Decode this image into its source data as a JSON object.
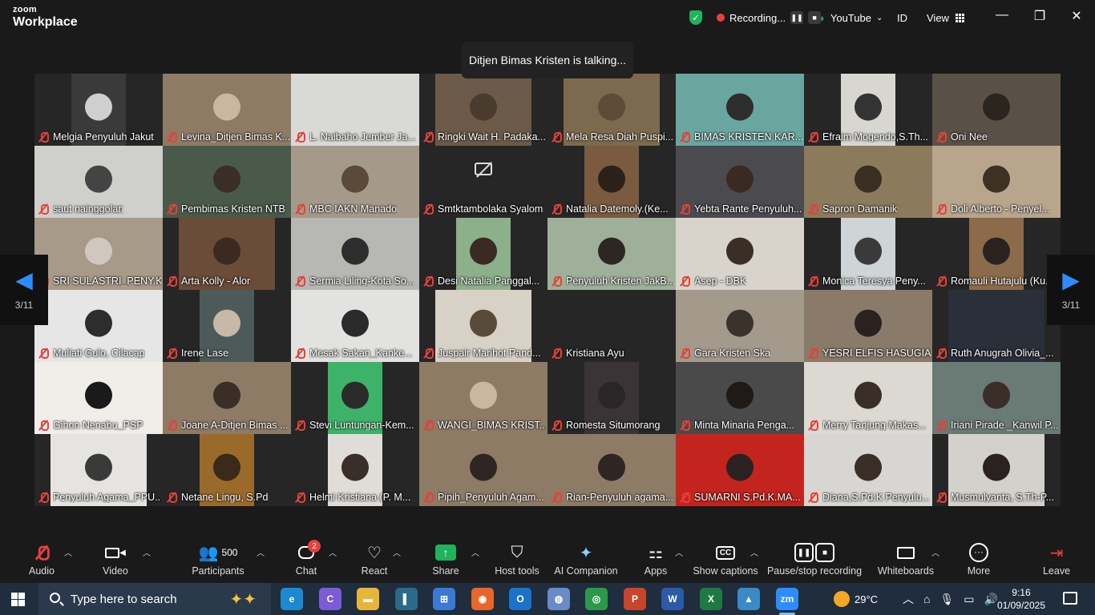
{
  "app": {
    "logo_top": "zoom",
    "logo_bottom": "Workplace"
  },
  "titlebar": {
    "recording_label": "Recording...",
    "stream_label": "YouTube",
    "id_label": "ID",
    "view_label": "View"
  },
  "talking_banner": "Ditjen Bimas Kristen is talking...",
  "pagination": {
    "left": "3/11",
    "right": "3/11"
  },
  "participants": [
    {
      "name": "Melgia Penyuluh Jakut",
      "bg": "#3a3a3a",
      "fg": "#cfcfcf",
      "vw": 68
    },
    {
      "name": "Levina_Ditjen Bimas K...",
      "bg": "#8d7b66",
      "fg": "#c9b7a1",
      "vw": 160
    },
    {
      "name": "L. Naibaho Jember Ja...",
      "bg": "#d9d9d6",
      "fg": "#d9d9d6",
      "vw": 160
    },
    {
      "name": "Ringki Wait H. Padaka...",
      "bg": "#6b5a48",
      "fg": "#4a3b2f",
      "vw": 120
    },
    {
      "name": "Mela Resa Diah Puspi...",
      "bg": "#7d6a4e",
      "fg": "#5e4b37",
      "vw": 120
    },
    {
      "name": "BIMAS KRISTEN KAR...",
      "bg": "#6aa6a0",
      "fg": "#2d2d2d",
      "vw": 160
    },
    {
      "name": "Efraim Mogendo,S.Th...",
      "bg": "#d8d6d0",
      "fg": "#333",
      "vw": 68
    },
    {
      "name": "Oni Nee",
      "bg": "#5a5146",
      "fg": "#2b2520",
      "vw": 160
    },
    {
      "name": "saut nainggolan",
      "bg": "#cfcfcb",
      "fg": "#444",
      "vw": 160
    },
    {
      "name": "Pembimas Kristen NTB",
      "bg": "#4a5a4a",
      "fg": "#3a2e26",
      "vw": 160
    },
    {
      "name": "MBC IAKN Manado",
      "bg": "#a59a8a",
      "fg": "#5b4a3a",
      "vw": 160
    },
    {
      "name": "Smtktambolaka Syalom",
      "bg": "#262626",
      "fg": "#262626",
      "vw": 0,
      "camoff": true
    },
    {
      "name": "Natalia Datemoly.(Ke...",
      "bg": "#7a5b40",
      "fg": "#2b211a",
      "vw": 68
    },
    {
      "name": "Yebta Rante Penyuluh...",
      "bg": "#4a4a4f",
      "fg": "#3a2a22",
      "vw": 160
    },
    {
      "name": "Sapron Damanik",
      "bg": "#8b7a5c",
      "fg": "#3a2e22",
      "vw": 160
    },
    {
      "name": "Doli Alberto - Penyel...",
      "bg": "#b8a58c",
      "fg": "#3f3024",
      "vw": 160
    },
    {
      "name": "SRI SULASTRI_PENY.K...",
      "bg": "#a89a88",
      "fg": "#d0c8be",
      "vw": 160
    },
    {
      "name": "Arta Kolly - Alor",
      "bg": "#6a4c38",
      "fg": "#3a2a20",
      "vw": 120
    },
    {
      "name": "Sermia Liling-Kota So...",
      "bg": "#b7b7b3",
      "fg": "#2d2d2d",
      "vw": 160
    },
    {
      "name": "Desi Natalia Panggal...",
      "bg": "#8bb08a",
      "fg": "#3a2a22",
      "vw": 68
    },
    {
      "name": "Penyuluh Kristen JakB...",
      "bg": "#9fb09a",
      "fg": "#2d2622",
      "vw": 160
    },
    {
      "name": "Asep - DBK",
      "bg": "#d8d4cc",
      "fg": "#3a2e26",
      "vw": 160
    },
    {
      "name": "Monica Teresya Peny...",
      "bg": "#cfd4d6",
      "fg": "#3a3a3a",
      "vw": 68
    },
    {
      "name": "Romauli Hutajulu (Ku...",
      "bg": "#8b6b4a",
      "fg": "#2a2220",
      "vw": 68
    },
    {
      "name": "Muliati Gulo, Cilacap",
      "bg": "#e6e6e6",
      "fg": "#2d2d2d",
      "vw": 160
    },
    {
      "name": "Irene Lase",
      "bg": "#4d5a5a",
      "fg": "#c8b8a8",
      "vw": 68
    },
    {
      "name": "Mesak Sakan_Kanke...",
      "bg": "#e2e2e0",
      "fg": "#2a2a2a",
      "vw": 160
    },
    {
      "name": "Juspair Marihot Pand...",
      "bg": "#d8d2c6",
      "fg": "#5a4a3a",
      "vw": 120
    },
    {
      "name": "Kristiana Ayu",
      "bg": "#262626",
      "fg": "#262626",
      "vw": 0
    },
    {
      "name": "Gara Kristen Ska",
      "bg": "#a49a8c",
      "fg": "#3a322c",
      "vw": 160
    },
    {
      "name": "YESRI ELFIS HASUGIA...",
      "bg": "#8a7a6a",
      "fg": "#2a2220",
      "vw": 160
    },
    {
      "name": "Ruth Anugrah Olivia_...",
      "bg": "#2a2f3a",
      "fg": "#2a2f3a",
      "vw": 120
    },
    {
      "name": "Gihon Nenabu_PSP",
      "bg": "#f1eeea",
      "fg": "#1a1a1a",
      "vw": 160
    },
    {
      "name": "Joane A-Ditjen Bimas ...",
      "bg": "#8d7b66",
      "fg": "#3a2e26",
      "vw": 160
    },
    {
      "name": "Stevi Luntungan-Kem...",
      "bg": "#3db36a",
      "fg": "#2a2a2a",
      "vw": 68
    },
    {
      "name": "WANGI_BIMAS KRIST...",
      "bg": "#8d7b66",
      "fg": "#c9b7a1",
      "vw": 160
    },
    {
      "name": "Romesta Situmorang",
      "bg": "#3a3436",
      "fg": "#2a2628",
      "vw": 68
    },
    {
      "name": "Minta Minaria Penga...",
      "bg": "#4a4a4a",
      "fg": "#1f1a18",
      "vw": 160
    },
    {
      "name": "Merry Tanjung Makas...",
      "bg": "#dcd8d2",
      "fg": "#3a2e28",
      "vw": 160
    },
    {
      "name": "Iriani Pirade _Kanwil P...",
      "bg": "#6a7a74",
      "fg": "#3a2e28",
      "vw": 160
    },
    {
      "name": "Penyuluh Agama_PPU...",
      "bg": "#e6e4e0",
      "fg": "#3a3a3a",
      "vw": 120
    },
    {
      "name": "Netane Lingu, S.Pd",
      "bg": "#9a6a2a",
      "fg": "#3a2a1a",
      "vw": 68
    },
    {
      "name": "Helmi Kristiana (P. M...",
      "bg": "#e0dcd8",
      "fg": "#3a2e28",
      "vw": 68
    },
    {
      "name": "Pipih_Penyuluh Agam...",
      "bg": "#8d7b66",
      "fg": "#2d2622",
      "vw": 160
    },
    {
      "name": "Rian-Penyuluh agama...",
      "bg": "#8d7b66",
      "fg": "#2d2622",
      "vw": 160
    },
    {
      "name": "SUMARNI S.Pd.K.MA...",
      "bg": "#c4241e",
      "fg": "#2a2220",
      "vw": 160
    },
    {
      "name": "Diana,S.Pd.K Penyulu...",
      "bg": "#d8d6d2",
      "fg": "#3a2e28",
      "vw": 160
    },
    {
      "name": "Musmulyanta, S.Th-P...",
      "bg": "#d4d0cc",
      "fg": "#2a2220",
      "vw": 120
    }
  ],
  "toolbar": {
    "audio": "Audio",
    "video": "Video",
    "participants": "Participants",
    "participants_count": "500",
    "chat": "Chat",
    "chat_badge": "2",
    "react": "React",
    "share": "Share",
    "host_tools": "Host tools",
    "ai_companion": "AI Companion",
    "apps": "Apps",
    "captions": "Show captions",
    "captions_icon_text": "CC",
    "pause_recording": "Pause/stop recording",
    "whiteboards": "Whiteboards",
    "more": "More",
    "leave": "Leave"
  },
  "taskbar": {
    "search_placeholder": "Type here to search",
    "weather": "29°C",
    "time": "9:16",
    "date": "01/09/2025",
    "apps": [
      {
        "icon": "edge-icon",
        "color": "#1b8ad0",
        "glyph": "e"
      },
      {
        "icon": "copilot-icon",
        "color": "#7b5bd6",
        "glyph": "C"
      },
      {
        "icon": "file-explorer-icon",
        "color": "#e7b53a",
        "glyph": "▬"
      },
      {
        "icon": "terminal-icon",
        "color": "#2a6a8a",
        "glyph": "▌"
      },
      {
        "icon": "store-icon",
        "color": "#3a7ad6",
        "glyph": "⊞"
      },
      {
        "icon": "firefox-icon",
        "color": "#e8662a",
        "glyph": "◉"
      },
      {
        "icon": "outlook-icon",
        "color": "#1a73c8",
        "glyph": "O"
      },
      {
        "icon": "browser-icon",
        "color": "#6a8ac8",
        "glyph": "◍"
      },
      {
        "icon": "chrome-icon",
        "color": "#2a9a4a",
        "glyph": "◎"
      },
      {
        "icon": "powerpoint-icon",
        "color": "#c8442a",
        "glyph": "P"
      },
      {
        "icon": "word-icon",
        "color": "#2a5aa8",
        "glyph": "W"
      },
      {
        "icon": "excel-icon",
        "color": "#1e7a42",
        "glyph": "X"
      },
      {
        "icon": "photos-icon",
        "color": "#3a8ac8",
        "glyph": "▲"
      },
      {
        "icon": "zoom-icon",
        "color": "#2d8cff",
        "glyph": "zm"
      }
    ]
  }
}
